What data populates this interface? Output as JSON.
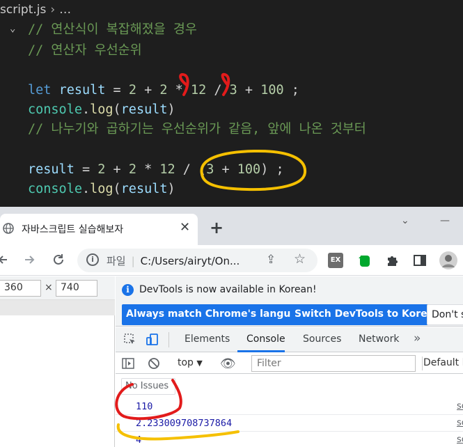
{
  "editor": {
    "breadcrumb_file": "script.js",
    "breadcrumb_more": "…",
    "lines": {
      "c1": "// 연산식이 복잡해졌을 경우",
      "c2": "// 연산자 우선순위",
      "l1_kw": "let",
      "l1_var": "result",
      "l1_eq": " = ",
      "l1_n1": "2",
      "l1_plus": " + ",
      "l1_n2": "2",
      "l1_mul": " * ",
      "l1_n3": "12",
      "l1_div": " / ",
      "l1_n4": "3",
      "l1_plus2": " + ",
      "l1_n5": "100",
      "l1_end": " ;",
      "log1_obj": "console",
      "log1_dot": ".",
      "log1_fn": "log",
      "log1_open": "(",
      "log1_arg": "result",
      "log1_close": ")",
      "c3": "// 나누기와 곱하기는 우선순위가 같음, 앞에 나온 것부터",
      "l2_var": "result",
      "l2_eq": " = ",
      "l2_n1": "2",
      "l2_plus": " + ",
      "l2_n2": "2",
      "l2_mul": " * ",
      "l2_n3": "12",
      "l2_div": " / ",
      "l2_open": "(",
      "l2_n4": "3",
      "l2_plus2": " + ",
      "l2_n5": "100",
      "l2_close": ")",
      "l2_end": " ;",
      "log2_obj": "console",
      "log2_dot": ".",
      "log2_fn": "log",
      "log2_open": "(",
      "log2_arg": "result",
      "log2_close": ")"
    }
  },
  "browser": {
    "tab_title": "자바스크립트 실습해보자",
    "tab_close": "✕",
    "new_tab": "+",
    "win_min": "⌄",
    "win_max": "—",
    "omnibox_label": "파일",
    "omnibox_url": "C:/Users/airyt/On...",
    "ext_label": "EX"
  },
  "device": {
    "width": "360",
    "height": "740",
    "times": "×"
  },
  "devtools": {
    "banner_text": "DevTools is now available in Korean!",
    "btn_match": "Always match Chrome's language",
    "btn_switch": "Switch DevTools to Korean",
    "btn_dont": "Don't s",
    "tabs": [
      "Elements",
      "Console",
      "Sources",
      "Network"
    ],
    "more": "»",
    "context": "top",
    "filter_placeholder": "Filter",
    "levels": "Default le",
    "issues": "No Issues",
    "output": [
      {
        "value": "110",
        "src": "sc"
      },
      {
        "value": "2.233009708737864",
        "src": "sc"
      },
      {
        "value": "4",
        "src": "sc"
      }
    ]
  }
}
